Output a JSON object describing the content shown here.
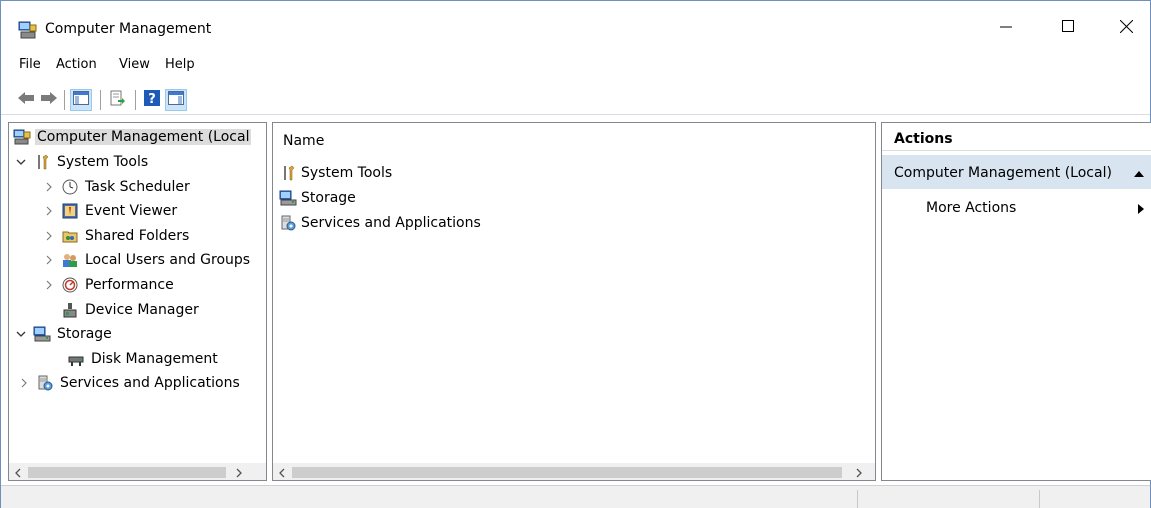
{
  "window": {
    "title": "Computer Management",
    "icon": "computer-management-icon",
    "controls": [
      "minimize-icon",
      "maximize-icon",
      "close-icon"
    ]
  },
  "menu": {
    "items": [
      {
        "label": "File"
      },
      {
        "label": "Action"
      },
      {
        "label": "View"
      },
      {
        "label": "Help"
      }
    ]
  },
  "toolbar": {
    "buttons": [
      {
        "icon": "back-arrow-icon"
      },
      {
        "icon": "forward-arrow-icon"
      },
      {
        "icon": "show-hide-console-tree-icon"
      },
      {
        "icon": "export-list-icon"
      },
      {
        "icon": "help-icon"
      },
      {
        "icon": "show-hide-action-pane-icon"
      }
    ]
  },
  "tree": {
    "items": [
      {
        "label": "Computer Management (Local",
        "icon": "computer-management-icon",
        "expander": "none",
        "selected": true
      },
      {
        "label": "System Tools",
        "icon": "system-tools-icon",
        "expander": "expanded"
      },
      {
        "label": "Task Scheduler",
        "icon": "clock-icon",
        "expander": "collapsed"
      },
      {
        "label": "Event Viewer",
        "icon": "event-viewer-icon",
        "expander": "collapsed"
      },
      {
        "label": "Shared Folders",
        "icon": "shared-folder-icon",
        "expander": "collapsed"
      },
      {
        "label": "Local Users and Groups",
        "icon": "users-icon",
        "expander": "collapsed"
      },
      {
        "label": "Performance",
        "icon": "performance-icon",
        "expander": "collapsed"
      },
      {
        "label": "Device Manager",
        "icon": "device-manager-icon",
        "expander": "none"
      },
      {
        "label": "Storage",
        "icon": "storage-icon",
        "expander": "expanded"
      },
      {
        "label": "Disk Management",
        "icon": "disk-icon",
        "expander": "none"
      },
      {
        "label": "Services and Applications",
        "icon": "services-icon",
        "expander": "collapsed"
      }
    ]
  },
  "list": {
    "column_header": "Name",
    "rows": [
      {
        "label": "System Tools",
        "icon": "system-tools-icon"
      },
      {
        "label": "Storage",
        "icon": "storage-icon"
      },
      {
        "label": "Services and Applications",
        "icon": "services-icon"
      }
    ]
  },
  "actions": {
    "header": "Actions",
    "group_title": "Computer Management (Local)",
    "group_arrow": "collapse-up-arrow-icon",
    "items": [
      {
        "label": "More Actions",
        "icon": "submenu-right-arrow-icon"
      }
    ]
  },
  "colors": {
    "selection": "#dcdcdc",
    "actions_group_bg": "#d9e4f1",
    "border": "#828790"
  }
}
